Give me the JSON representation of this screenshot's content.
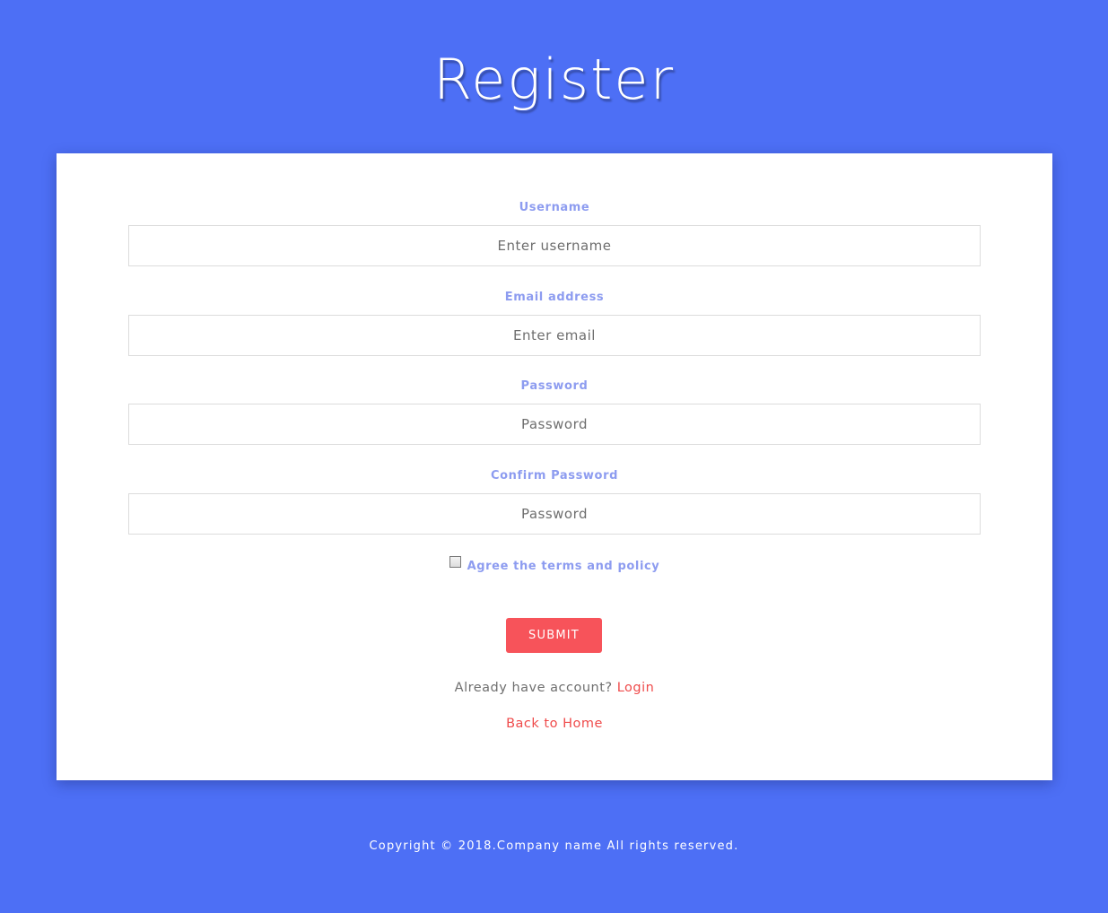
{
  "page": {
    "title": "Register"
  },
  "form": {
    "username": {
      "label": "Username",
      "placeholder": "Enter username",
      "value": ""
    },
    "email": {
      "label": "Email address",
      "placeholder": "Enter email",
      "value": ""
    },
    "password": {
      "label": "Password",
      "placeholder": "Password",
      "value": ""
    },
    "confirm_password": {
      "label": "Confirm Password",
      "placeholder": "Password",
      "value": ""
    },
    "agree": {
      "label": "Agree the terms and policy",
      "checked": false
    },
    "submit_label": "SUBMIT",
    "login_prompt": "Already have account?",
    "login_link": "Login",
    "home_link": "Back to Home"
  },
  "footer": {
    "copyright": "Copyright © 2018.Company name All rights reserved."
  },
  "colors": {
    "background": "#4d6ff5",
    "label": "#8d9cf0",
    "accent": "#f7535a",
    "link": "#ef4b4b"
  }
}
